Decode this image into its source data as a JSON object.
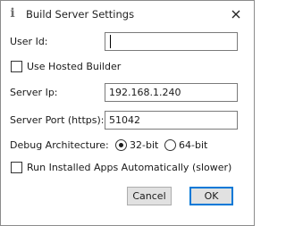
{
  "window": {
    "title": "Build Server Settings",
    "title_icon": "info-icon",
    "close_icon": "close-icon"
  },
  "fields": {
    "user_id": {
      "label": "User Id:",
      "value": ""
    },
    "use_hosted_builder": {
      "label": "Use Hosted Builder",
      "checked": false
    },
    "server_ip": {
      "label": "Server Ip:",
      "value": "192.168.1.240"
    },
    "server_port": {
      "label": "Server Port (https):",
      "value": "51042"
    },
    "debug_architecture": {
      "label": "Debug Architecture:",
      "options": [
        {
          "label": "32-bit",
          "selected": true
        },
        {
          "label": "64-bit",
          "selected": false
        }
      ]
    },
    "run_installed_apps": {
      "label": "Run Installed Apps Automatically (slower)",
      "checked": false
    }
  },
  "buttons": {
    "cancel": "Cancel",
    "ok": "OK"
  },
  "colors": {
    "accent": "#0078d7",
    "button_face": "#e1e1e1",
    "border": "#7a7a7a"
  }
}
